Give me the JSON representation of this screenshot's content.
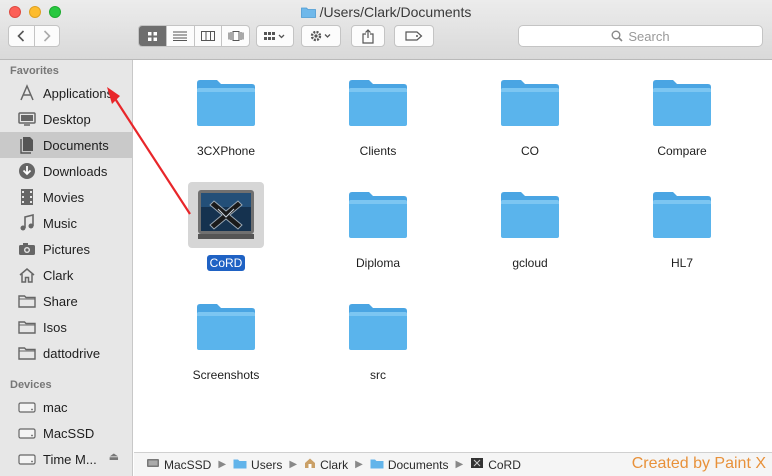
{
  "window": {
    "title": "/Users/Clark/Documents"
  },
  "search": {
    "placeholder": "Search"
  },
  "sidebar": {
    "favorites_header": "Favorites",
    "favorites": [
      {
        "label": "Applications",
        "icon": "applications-icon"
      },
      {
        "label": "Desktop",
        "icon": "desktop-icon"
      },
      {
        "label": "Documents",
        "icon": "documents-icon",
        "selected": true
      },
      {
        "label": "Downloads",
        "icon": "downloads-icon"
      },
      {
        "label": "Movies",
        "icon": "movies-icon"
      },
      {
        "label": "Music",
        "icon": "music-icon"
      },
      {
        "label": "Pictures",
        "icon": "pictures-icon"
      },
      {
        "label": "Clark",
        "icon": "home-icon"
      },
      {
        "label": "Share",
        "icon": "folder-icon"
      },
      {
        "label": "Isos",
        "icon": "folder-icon"
      },
      {
        "label": "dattodrive",
        "icon": "folder-icon"
      }
    ],
    "devices_header": "Devices",
    "devices": [
      {
        "label": "mac",
        "icon": "disk-icon"
      },
      {
        "label": "MacSSD",
        "icon": "disk-icon"
      },
      {
        "label": "Time M...",
        "icon": "disk-icon",
        "ejectable": true
      }
    ]
  },
  "files": [
    {
      "name": "3CXPhone",
      "type": "folder"
    },
    {
      "name": "Clients",
      "type": "folder"
    },
    {
      "name": "CO",
      "type": "folder"
    },
    {
      "name": "Compare",
      "type": "folder"
    },
    {
      "name": "CoRD",
      "type": "app",
      "selected": true
    },
    {
      "name": "Diploma",
      "type": "folder"
    },
    {
      "name": "gcloud",
      "type": "folder"
    },
    {
      "name": "HL7",
      "type": "folder"
    },
    {
      "name": "Screenshots",
      "type": "folder"
    },
    {
      "name": "src",
      "type": "folder"
    }
  ],
  "pathbar": [
    "MacSSD",
    "Users",
    "Clark",
    "Documents",
    "CoRD"
  ],
  "watermark": "Created by Paint X",
  "colors": {
    "folder": "#5ab4ec",
    "selection": "#1f62c4",
    "annotation_arrow": "#e8262a",
    "watermark": "#e8913a"
  }
}
